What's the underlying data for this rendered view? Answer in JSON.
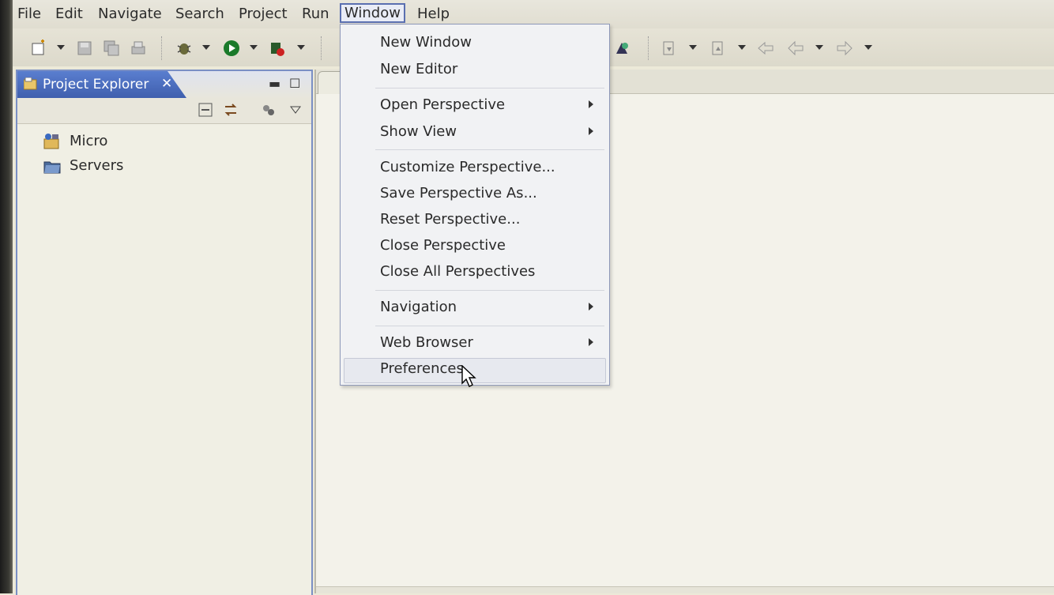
{
  "menubar": {
    "items": [
      "File",
      "Edit",
      "Navigate",
      "Search",
      "Project",
      "Run",
      "Window",
      "Help"
    ],
    "open_menu": "Window"
  },
  "project_explorer": {
    "title": "Project Explorer",
    "close_glyph": "✕",
    "tree": [
      {
        "label": "Micro",
        "icon": "project-icon"
      },
      {
        "label": "Servers",
        "icon": "folder-icon"
      }
    ]
  },
  "window_menu": {
    "items": [
      {
        "label": "New Window",
        "submenu": false
      },
      {
        "label": "New Editor",
        "submenu": false
      },
      {
        "label": "Open Perspective",
        "submenu": true
      },
      {
        "label": "Show View",
        "submenu": true
      },
      {
        "label": "Customize Perspective...",
        "submenu": false
      },
      {
        "label": "Save Perspective As...",
        "submenu": false
      },
      {
        "label": "Reset Perspective...",
        "submenu": false
      },
      {
        "label": "Close Perspective",
        "submenu": false
      },
      {
        "label": "Close All Perspectives",
        "submenu": false
      },
      {
        "label": "Navigation",
        "submenu": true
      },
      {
        "label": "Web Browser",
        "submenu": true
      },
      {
        "label": "Preferences",
        "submenu": false
      }
    ],
    "hovered": "Preferences"
  },
  "colors": {
    "active_tab": "#4a6cc0",
    "menu_border": "#8e98b8",
    "background": "#ece9d8"
  }
}
